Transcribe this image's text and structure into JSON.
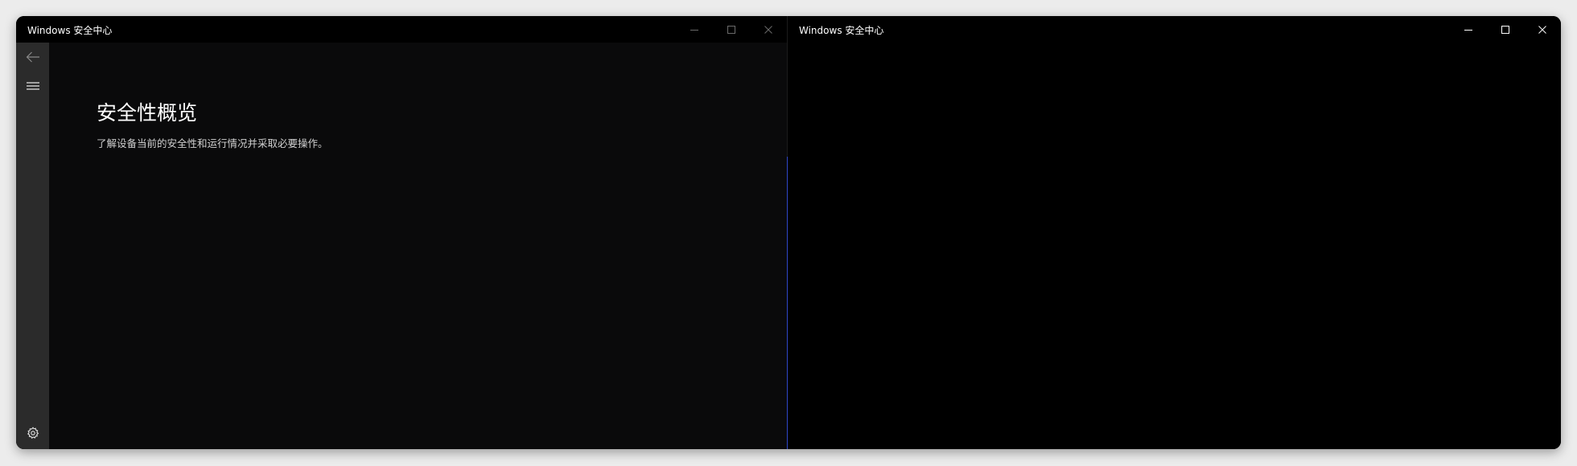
{
  "window_left": {
    "title": "Windows 安全中心",
    "page_title": "安全性概览",
    "page_subtitle": "了解设备当前的安全性和运行情况并采取必要操作。"
  },
  "window_right": {
    "title": "Windows 安全中心"
  },
  "icons": {
    "back": "back-arrow-icon",
    "menu": "hamburger-menu-icon",
    "settings": "gear-icon",
    "minimize": "minimize-icon",
    "maximize": "maximize-icon",
    "close": "close-icon"
  },
  "colors": {
    "nav_rail": "#2b2b2b",
    "content_bg": "#0a0a0b",
    "accent_edge": "#2f47c8"
  }
}
